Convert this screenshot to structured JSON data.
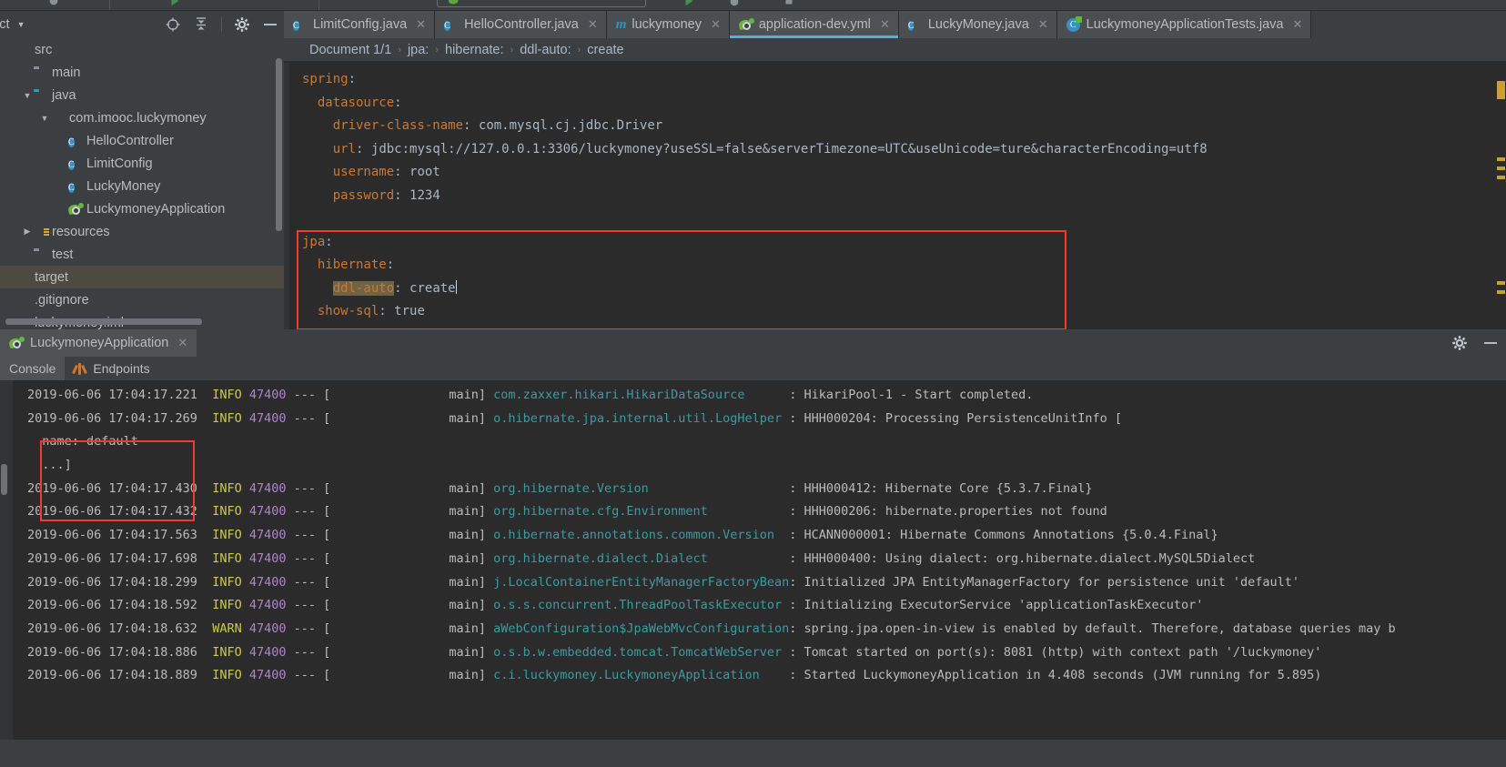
{
  "project_panel": {
    "title": "ject",
    "tools": [
      "locate-icon",
      "collapse-all-icon",
      "settings-icon",
      "hide-icon"
    ],
    "tree": [
      {
        "label": "src",
        "indent": 0,
        "twist": "",
        "icon": "module-mark"
      },
      {
        "label": "main",
        "indent": 1,
        "twist": "",
        "icon": "folder"
      },
      {
        "label": "java",
        "indent": 1,
        "twist": "▼",
        "icon": "folder-blue"
      },
      {
        "label": "com.imooc.luckymoney",
        "indent": 2,
        "twist": "▼",
        "icon": "package"
      },
      {
        "label": "HelloController",
        "indent": 3,
        "twist": "",
        "icon": "class"
      },
      {
        "label": "LimitConfig",
        "indent": 3,
        "twist": "",
        "icon": "class"
      },
      {
        "label": "LuckyMoney",
        "indent": 3,
        "twist": "",
        "icon": "class"
      },
      {
        "label": "LuckymoneyApplication",
        "indent": 3,
        "twist": "",
        "icon": "spring-boot"
      },
      {
        "label": "resources",
        "indent": 1,
        "twist": "▶",
        "icon": "resources"
      },
      {
        "label": "test",
        "indent": 1,
        "twist": "",
        "icon": "folder"
      },
      {
        "label": "target",
        "indent": 0,
        "twist": "",
        "icon": "mark-orange",
        "state": "selected"
      },
      {
        "label": ".gitignore",
        "indent": 0,
        "twist": "",
        "icon": "mark-grey"
      },
      {
        "label": "luckymoney.iml",
        "indent": 0,
        "twist": "",
        "icon": "mark-grey"
      }
    ]
  },
  "editor": {
    "tabs": [
      {
        "label": "LimitConfig.java",
        "icon": "class-icon",
        "active": false,
        "closable": true
      },
      {
        "label": "HelloController.java",
        "icon": "class-icon",
        "active": false,
        "closable": true
      },
      {
        "label": "luckymoney",
        "icon": "maven-icon",
        "active": false,
        "closable": true
      },
      {
        "label": "application-dev.yml",
        "icon": "spring-boot-icon",
        "active": true,
        "closable": true
      },
      {
        "label": "LuckyMoney.java",
        "icon": "class-icon",
        "active": false,
        "closable": true
      },
      {
        "label": "LuckymoneyApplicationTests.java",
        "icon": "test-class-icon",
        "active": false,
        "closable": true
      }
    ],
    "breadcrumb": [
      "Document 1/1",
      "jpa:",
      "hibernate:",
      "ddl-auto:",
      "create"
    ],
    "code_lines": [
      {
        "indent": 0,
        "key": "spring",
        "colon": ":",
        "value": ""
      },
      {
        "indent": 1,
        "key": "datasource",
        "colon": ":",
        "value": ""
      },
      {
        "indent": 2,
        "key": "driver-class-name",
        "colon": ":",
        "value": "com.mysql.cj.jdbc.Driver"
      },
      {
        "indent": 2,
        "key": "url",
        "colon": ":",
        "value": "jdbc:mysql://127.0.0.1:3306/luckymoney?useSSL=false&serverTimezone=UTC&useUnicode=ture&characterEncoding=utf8"
      },
      {
        "indent": 2,
        "key": "username",
        "colon": ":",
        "value": "root"
      },
      {
        "indent": 2,
        "key": "password",
        "colon": ":",
        "value": "1234"
      },
      {
        "indent": 0,
        "key": "",
        "colon": "",
        "value": ""
      },
      {
        "indent": 0,
        "key": "jpa",
        "colon": ":",
        "value": ""
      },
      {
        "indent": 1,
        "key": "hibernate",
        "colon": ":",
        "value": ""
      },
      {
        "indent": 2,
        "key": "ddl-auto",
        "colon": ":",
        "value": "create",
        "highlight": true,
        "caret": true
      },
      {
        "indent": 1,
        "key": "show-sql",
        "colon": ":",
        "value": "true"
      }
    ],
    "annotation_color": "#f4392f"
  },
  "run_window": {
    "tab_label": "LuckymoneyApplication",
    "tab_icon": "spring-boot-running-icon",
    "actions": [
      "settings-icon",
      "minimize-icon"
    ],
    "sub_tabs": [
      {
        "label": "Console",
        "active": true,
        "icon": ""
      },
      {
        "label": "Endpoints",
        "active": false,
        "icon": "endpoints-icon"
      }
    ],
    "console_lines": [
      {
        "date": "2019-06-06 17:04:17.221",
        "level": "INFO",
        "pid": "47400",
        "thread": "main]",
        "logger": "com.zaxxer.hikari.HikariDataSource",
        "msg": "HikariPool-1 - Start completed."
      },
      {
        "date": "2019-06-06 17:04:17.269",
        "level": "INFO",
        "pid": "47400",
        "thread": "main]",
        "logger": "o.hibernate.jpa.internal.util.LogHelper",
        "msg": "HHH000204: Processing PersistenceUnitInfo ["
      },
      {
        "plain": "name: default",
        "indent": true
      },
      {
        "plain": "...]",
        "indent": true
      },
      {
        "date": "2019-06-06 17:04:17.430",
        "level": "INFO",
        "pid": "47400",
        "thread": "main]",
        "logger": "org.hibernate.Version",
        "msg": "HHH000412: Hibernate Core {5.3.7.Final}"
      },
      {
        "date": "2019-06-06 17:04:17.432",
        "level": "INFO",
        "pid": "47400",
        "thread": "main]",
        "logger": "org.hibernate.cfg.Environment",
        "msg": "HHH000206: hibernate.properties not found"
      },
      {
        "date": "2019-06-06 17:04:17.563",
        "level": "INFO",
        "pid": "47400",
        "thread": "main]",
        "logger": "o.hibernate.annotations.common.Version",
        "msg": "HCANN000001: Hibernate Commons Annotations {5.0.4.Final}"
      },
      {
        "date": "2019-06-06 17:04:17.698",
        "level": "INFO",
        "pid": "47400",
        "thread": "main]",
        "logger": "org.hibernate.dialect.Dialect",
        "msg": "HHH000400: Using dialect: org.hibernate.dialect.MySQL5Dialect"
      },
      {
        "date": "2019-06-06 17:04:18.299",
        "level": "INFO",
        "pid": "47400",
        "thread": "main]",
        "logger": "j.LocalContainerEntityManagerFactoryBean",
        "msg": "Initialized JPA EntityManagerFactory for persistence unit 'default'"
      },
      {
        "date": "2019-06-06 17:04:18.592",
        "level": "INFO",
        "pid": "47400",
        "thread": "main]",
        "logger": "o.s.s.concurrent.ThreadPoolTaskExecutor",
        "msg": "Initializing ExecutorService 'applicationTaskExecutor'"
      },
      {
        "date": "2019-06-06 17:04:18.632",
        "level": "WARN",
        "pid": "47400",
        "thread": "main]",
        "logger": "aWebConfiguration$JpaWebMvcConfiguration",
        "msg": "spring.jpa.open-in-view is enabled by default. Therefore, database queries may b"
      },
      {
        "date": "2019-06-06 17:04:18.886",
        "level": "INFO",
        "pid": "47400",
        "thread": "main]",
        "logger": "o.s.b.w.embedded.tomcat.TomcatWebServer",
        "msg": "Tomcat started on port(s): 8081 (http) with context path '/luckymoney'"
      },
      {
        "date": "2019-06-06 17:04:18.889",
        "level": "INFO",
        "pid": "47400",
        "thread": "main]",
        "logger": "c.i.luckymoney.LuckymoneyApplication",
        "msg": "Started LuckymoneyApplication in 4.408 seconds (JVM running for 5.895)"
      }
    ]
  },
  "colors": {
    "accent": "#4eb3d4",
    "annotation": "#f4392f",
    "yaml_key": "#cc7832",
    "yaml_value": "#a9b7c6",
    "logger": "#3d9aa1",
    "level": "#cbcb41",
    "pid": "#b084cc",
    "editor_bg": "#2b2b2b",
    "chrome_bg": "#3c3f41"
  }
}
